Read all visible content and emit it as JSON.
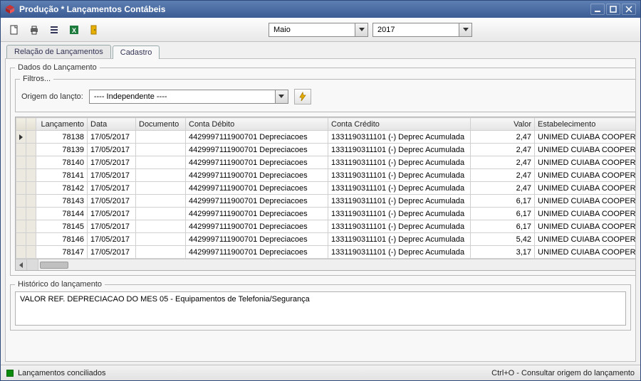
{
  "window": {
    "title": "Produção * Lançamentos Contábeis"
  },
  "toolbar": {
    "month": "Maio",
    "year": "2017"
  },
  "tabs": {
    "relacao": "Relação de Lançamentos",
    "cadastro": "Cadastro"
  },
  "fieldset": {
    "dados_legend": "Dados do Lançamento",
    "filtros_legend": "Filtros...",
    "origem_label": "Origem do lançto:",
    "origem_value": "---- Independente ----",
    "historico_legend": "Histórico do lançamento"
  },
  "grid": {
    "headers": {
      "lancamento": "Lançamento",
      "data": "Data",
      "documento": "Documento",
      "conta_debito": "Conta Débito",
      "conta_credito": "Conta Crédito",
      "valor": "Valor",
      "estabelecimento": "Estabelecimento"
    },
    "rows": [
      {
        "lanc": "78138",
        "data": "17/05/2017",
        "doc": "",
        "deb": "4429997111900701 Depreciacoes",
        "cred": "1331190311101 (-) Deprec Acumulada",
        "val": "2,47",
        "est": "UNIMED CUIABA COOPERAT"
      },
      {
        "lanc": "78139",
        "data": "17/05/2017",
        "doc": "",
        "deb": "4429997111900701 Depreciacoes",
        "cred": "1331190311101 (-) Deprec Acumulada",
        "val": "2,47",
        "est": "UNIMED CUIABA COOPERAT"
      },
      {
        "lanc": "78140",
        "data": "17/05/2017",
        "doc": "",
        "deb": "4429997111900701 Depreciacoes",
        "cred": "1331190311101 (-) Deprec Acumulada",
        "val": "2,47",
        "est": "UNIMED CUIABA COOPERAT"
      },
      {
        "lanc": "78141",
        "data": "17/05/2017",
        "doc": "",
        "deb": "4429997111900701 Depreciacoes",
        "cred": "1331190311101 (-) Deprec Acumulada",
        "val": "2,47",
        "est": "UNIMED CUIABA COOPERAT"
      },
      {
        "lanc": "78142",
        "data": "17/05/2017",
        "doc": "",
        "deb": "4429997111900701 Depreciacoes",
        "cred": "1331190311101 (-) Deprec Acumulada",
        "val": "2,47",
        "est": "UNIMED CUIABA COOPERAT"
      },
      {
        "lanc": "78143",
        "data": "17/05/2017",
        "doc": "",
        "deb": "4429997111900701 Depreciacoes",
        "cred": "1331190311101 (-) Deprec Acumulada",
        "val": "6,17",
        "est": "UNIMED CUIABA COOPERAT"
      },
      {
        "lanc": "78144",
        "data": "17/05/2017",
        "doc": "",
        "deb": "4429997111900701 Depreciacoes",
        "cred": "1331190311101 (-) Deprec Acumulada",
        "val": "6,17",
        "est": "UNIMED CUIABA COOPERAT"
      },
      {
        "lanc": "78145",
        "data": "17/05/2017",
        "doc": "",
        "deb": "4429997111900701 Depreciacoes",
        "cred": "1331190311101 (-) Deprec Acumulada",
        "val": "6,17",
        "est": "UNIMED CUIABA COOPERAT"
      },
      {
        "lanc": "78146",
        "data": "17/05/2017",
        "doc": "",
        "deb": "4429997111900701 Depreciacoes",
        "cred": "1331190311101 (-) Deprec Acumulada",
        "val": "5,42",
        "est": "UNIMED CUIABA COOPERAT"
      },
      {
        "lanc": "78147",
        "data": "17/05/2017",
        "doc": "",
        "deb": "4429997111900701 Depreciacoes",
        "cred": "1331190311101 (-) Deprec Acumulada",
        "val": "3,17",
        "est": "UNIMED CUIABA COOPERAT"
      }
    ]
  },
  "historico": {
    "text": "VALOR REF. DEPRECIACAO DO MES 05 - Equipamentos de Telefonia/Segurança"
  },
  "status": {
    "left": "Lançamentos conciliados",
    "right": "Ctrl+O - Consultar origem do lançamento"
  }
}
